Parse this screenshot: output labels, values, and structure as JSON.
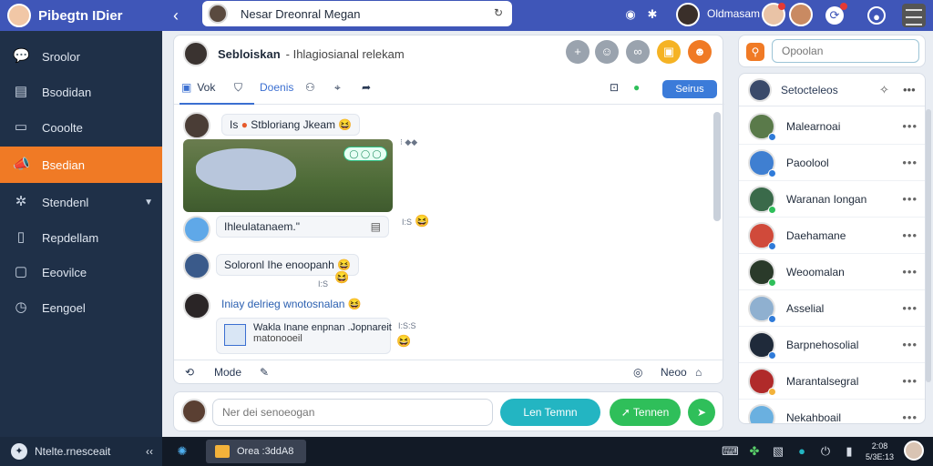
{
  "brand": {
    "title": "Pibegtn IDier"
  },
  "topbar": {
    "chat_title": "Nesar Dreonral Megan",
    "user_name": "Oldmasam"
  },
  "sidebar": {
    "items": [
      {
        "label": "Sroolor",
        "icon": "chat-bubble-icon"
      },
      {
        "label": "Bsodidan",
        "icon": "folder-icon"
      },
      {
        "label": "Cooolte",
        "icon": "file-icon"
      },
      {
        "label": "Bsedian",
        "icon": "megaphone-icon",
        "active": true
      },
      {
        "label": "Stendenl",
        "icon": "people-icon",
        "has_chevron": true
      },
      {
        "label": "Repdellam",
        "icon": "document-icon"
      },
      {
        "label": "Eeovilce",
        "icon": "clipboard-icon"
      },
      {
        "label": "Eengoel",
        "icon": "clock-icon"
      }
    ],
    "footer_label": "Ntelte.rnesceait"
  },
  "chat": {
    "header_name": "Sebloiskan",
    "header_sub": "- Ihlagiosianal relekam",
    "toolbar": {
      "tab1": "Vok",
      "tab2": "Doenis",
      "action_button": "Seirus"
    },
    "messages": [
      {
        "prefix": "Is",
        "text": "Stbloriang Jkeam",
        "meta": "⁝ ◆◆"
      },
      {
        "image_chip": "◯ ◯ ◯",
        "caption": "Ihleulatanaem.\"",
        "meta": "I:S"
      },
      {
        "text": "Soloronl Ihe enoopanh",
        "meta": "I:S"
      },
      {
        "text": "Iniay delrieg wnotosnalan",
        "attachment": "Wakla Inane enpnan .Jopnareit",
        "attachment_sub": "matonooeil",
        "meta": "I:S:S"
      }
    ],
    "footer": {
      "left_label": "Mode",
      "right_label": "Neoo"
    }
  },
  "composer": {
    "placeholder": "Ner dei senoeogan",
    "button_primary": "Len Temnn",
    "button_secondary": "Tennen"
  },
  "right_panel": {
    "search_placeholder": "Opoolan",
    "contacts_title": "Setocteleos",
    "contacts": [
      {
        "name": "Malearnoai",
        "status": "#2f7bd9"
      },
      {
        "name": "Paoolool",
        "status": "#2f7bd9"
      },
      {
        "name": "Waranan Iongan",
        "status": "#2fbf5a"
      },
      {
        "name": "Daehamane",
        "status": "#2f7bd9"
      },
      {
        "name": "Weoomalan",
        "status": "#2fbf5a"
      },
      {
        "name": "Asselial",
        "status": "#2f7bd9"
      },
      {
        "name": "Barpnehosolial",
        "status": "#2f7bd9"
      },
      {
        "name": "Marantalsegral",
        "status": "#f3b23a"
      },
      {
        "name": "Nekahboail",
        "status": "#2f7bd9"
      }
    ]
  },
  "taskbar": {
    "app_label": "Orea :3ddA8",
    "time": "2:08",
    "date": "5/3E:13"
  },
  "colors": {
    "topbar": "#3f56b8",
    "sidebar": "#1f3048",
    "accent": "#f07a25",
    "teal_button": "#23b5c2",
    "green_button": "#2fbf5a"
  }
}
